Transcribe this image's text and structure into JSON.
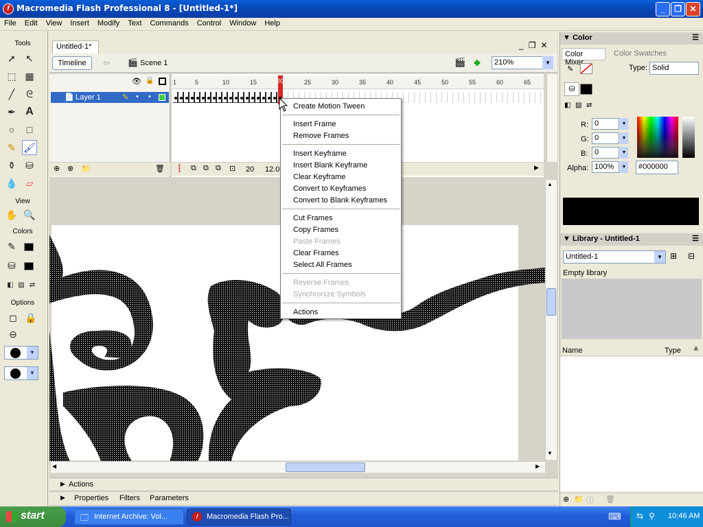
{
  "window": {
    "title": "Macromedia Flash Professional 8 - [Untitled-1*]",
    "controls": [
      "_",
      "❐",
      "✕"
    ]
  },
  "menubar": [
    "File",
    "Edit",
    "View",
    "Insert",
    "Modify",
    "Text",
    "Commands",
    "Control",
    "Window",
    "Help"
  ],
  "tools": {
    "title": "Tools",
    "view_label": "View",
    "colors_label": "Colors",
    "options_label": "Options"
  },
  "document": {
    "tab": "Untitled-1*",
    "doc_controls": [
      "_",
      "❐",
      "✕"
    ],
    "timeline_button": "Timeline",
    "scene": "Scene 1",
    "zoom": "210%"
  },
  "timeline": {
    "layer_name": "Layer 1",
    "ruler": [
      "1",
      "5",
      "10",
      "15",
      "20",
      "25",
      "30",
      "35",
      "40",
      "45",
      "50",
      "55",
      "60",
      "65"
    ],
    "current_frame": "20",
    "frame_rate": "12.0"
  },
  "context_menu": {
    "items": [
      {
        "label": "Create Motion Tween",
        "enabled": true
      },
      {
        "sep": true
      },
      {
        "label": "Insert Frame",
        "enabled": true
      },
      {
        "label": "Remove Frames",
        "enabled": true
      },
      {
        "sep": true
      },
      {
        "label": "Insert Keyframe",
        "enabled": true
      },
      {
        "label": "Insert Blank Keyframe",
        "enabled": true
      },
      {
        "label": "Clear Keyframe",
        "enabled": true
      },
      {
        "label": "Convert to Keyframes",
        "enabled": true
      },
      {
        "label": "Convert to Blank Keyframes",
        "enabled": true
      },
      {
        "sep": true
      },
      {
        "label": "Cut Frames",
        "enabled": true
      },
      {
        "label": "Copy Frames",
        "enabled": true
      },
      {
        "label": "Paste Frames",
        "enabled": false
      },
      {
        "label": "Clear Frames",
        "enabled": true
      },
      {
        "label": "Select All Frames",
        "enabled": true
      },
      {
        "sep": true
      },
      {
        "label": "Reverse Frames",
        "enabled": false
      },
      {
        "label": "Synchronize Symbols",
        "enabled": false
      },
      {
        "sep": true
      },
      {
        "label": "Actions",
        "enabled": true
      }
    ]
  },
  "panels_bottom": {
    "actions": "Actions",
    "properties": "Properties",
    "filters": "Filters",
    "parameters": "Parameters"
  },
  "color_panel": {
    "title": "Color",
    "tab_mixer": "Color Mixer",
    "tab_swatches": "Color Swatches",
    "type_label": "Type:",
    "type_value": "Solid",
    "r_label": "R:",
    "r_value": "0",
    "g_label": "G:",
    "g_value": "0",
    "b_label": "B:",
    "b_value": "0",
    "alpha_label": "Alpha:",
    "alpha_value": "100%",
    "hex_value": "#000000",
    "preview_color": "#000000"
  },
  "library_panel": {
    "title": "Library - Untitled-1",
    "selected_doc": "Untitled-1",
    "status": "Empty library",
    "col_name": "Name",
    "col_type": "Type"
  },
  "taskbar": {
    "start": "start",
    "items": [
      "Internet Archive: Vol...",
      "Macromedia Flash Pro..."
    ],
    "clock": "10:46 AM"
  }
}
